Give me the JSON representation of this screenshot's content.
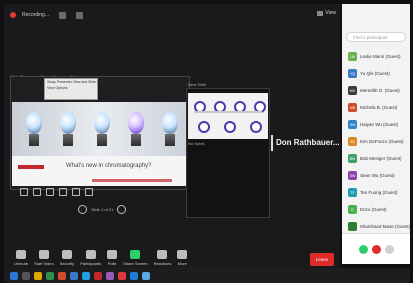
{
  "topbar": {
    "recording_label": "Recording...",
    "view_label": "View"
  },
  "share": {
    "toolbar_labels": [
      "Slide Show",
      "Share View",
      "Pause"
    ],
    "dropdown_options": [
      "Swap Presenter View and Slide Show",
      "View Options"
    ],
    "slide_title": "What's new in chromatography?",
    "pager_text": "Slide 1 of 21",
    "thumb_title": "Next Slide",
    "thumb_caption": "No Notes"
  },
  "speaker": {
    "name": "Don Rathbauer..."
  },
  "controls": {
    "items": [
      {
        "label": "Unmute",
        "icon": "microphone-icon"
      },
      {
        "label": "Start Video",
        "icon": "camera-icon"
      },
      {
        "label": "Security",
        "icon": "shield-icon"
      },
      {
        "label": "Participants",
        "icon": "people-icon",
        "count": "22"
      },
      {
        "label": "Polls",
        "icon": "poll-icon"
      },
      {
        "label": "Share Screen",
        "icon": "share-screen-icon"
      },
      {
        "label": "Reactions",
        "icon": "reaction-icon"
      },
      {
        "label": "More",
        "icon": "more-icon"
      }
    ],
    "end_label": "Leave"
  },
  "participants": {
    "search_placeholder": "Find a participant",
    "list": [
      {
        "initials": "LM",
        "name": "Leslie Marin (Guest)",
        "color": "#6ab04c"
      },
      {
        "initials": "YQ",
        "name": "Yu Qin (Guest)",
        "color": "#3c78c8"
      },
      {
        "initials": "MO",
        "name": "Meredith O. (Guest)",
        "color": "#3a3a3a"
      },
      {
        "initials": "MB",
        "name": "Michela B. (Guest)",
        "color": "#d14a2b"
      },
      {
        "initials": "HW",
        "name": "Haiyan Wu (Guest)",
        "color": "#2c86c9"
      },
      {
        "initials": "KD",
        "name": "Kim DeFonzo (Guest)",
        "color": "#d98a1f"
      },
      {
        "initials": "BM",
        "name": "Bob Mesiger (Guest)",
        "color": "#3fa06a"
      },
      {
        "initials": "SW",
        "name": "Sean Wu (Guest)",
        "color": "#8e44ad"
      },
      {
        "initials": "TF",
        "name": "Ten Fuong (Guest)",
        "color": "#1f9db3"
      },
      {
        "initials": "E",
        "name": "Enzo (Guest)",
        "color": "#4caf50"
      },
      {
        "initials": "",
        "name": "Shamhaed Mase (Guest)",
        "color": "#2e7d32"
      }
    ],
    "bottom_buttons": [
      {
        "label": "",
        "color": "#2ecf6a"
      },
      {
        "label": "",
        "color": "#e02b2b"
      },
      {
        "label": "",
        "color": "#d0d0d0"
      }
    ]
  }
}
